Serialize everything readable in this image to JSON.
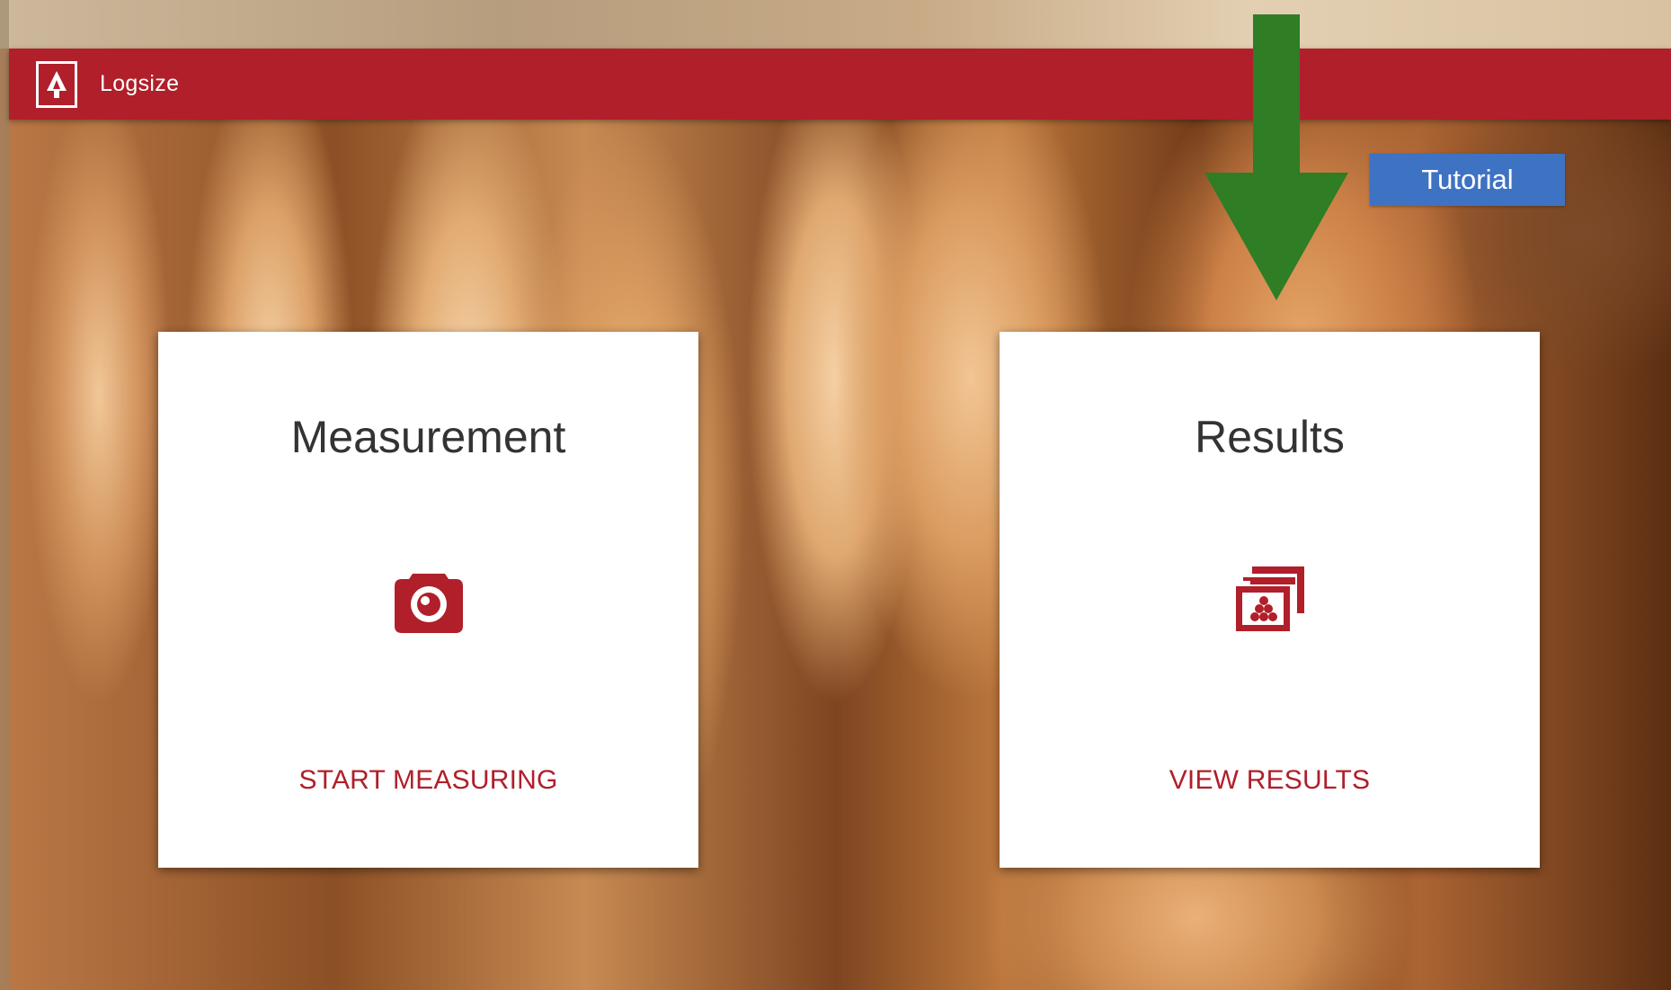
{
  "app": {
    "title": "Logsize",
    "logo_icon": "tree-icon",
    "appbar_color": "#b01f2a"
  },
  "tutorial": {
    "label": "Tutorial",
    "color": "#3e72c3"
  },
  "annotation": {
    "arrow_icon": "arrow-down-icon",
    "color": "#2f7d24"
  },
  "cards": [
    {
      "title": "Measurement",
      "icon": "camera-icon",
      "action_label": "START MEASURING"
    },
    {
      "title": "Results",
      "icon": "gallery-icon",
      "action_label": "VIEW RESULTS"
    }
  ]
}
